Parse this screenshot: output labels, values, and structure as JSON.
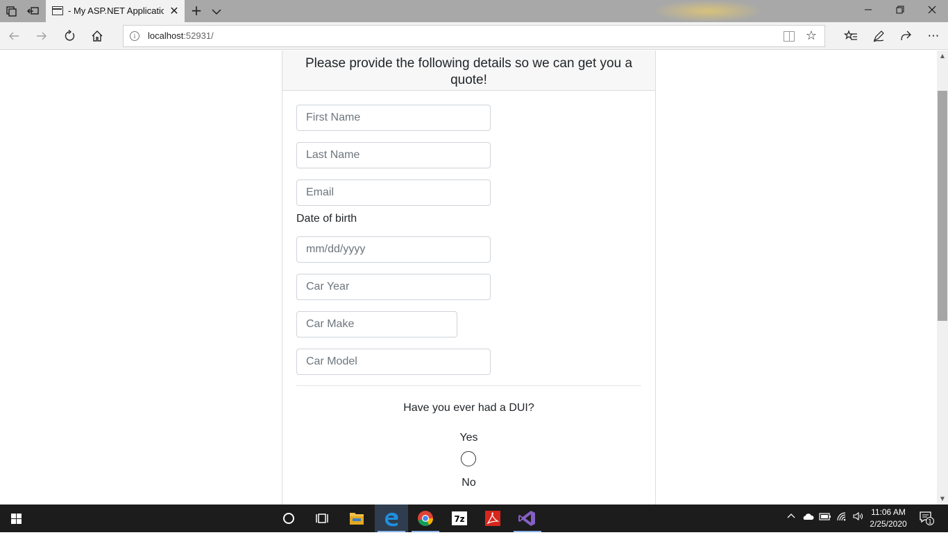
{
  "browser": {
    "tab_title": "- My ASP.NET Applicatio",
    "url_host": "localhost",
    "url_port": ":52931/"
  },
  "page": {
    "heading": "Please provide the following details so we can get you a quote!",
    "fields": {
      "first_name": "First Name",
      "last_name": "Last Name",
      "email": "Email",
      "dob_label": "Date of birth",
      "dob_placeholder": "mm/dd/yyyy",
      "car_year": "Car Year",
      "car_make": "Car Make",
      "car_model": "Car Model"
    },
    "dui_question": "Have you ever had a DUI?",
    "dui_yes": "Yes",
    "dui_no": "No"
  },
  "taskbar": {
    "time": "11:06 AM",
    "date": "2/25/2020",
    "apps": [
      "cortana-icon",
      "task-view-icon",
      "file-explorer-icon",
      "edge-icon",
      "chrome-icon",
      "7zip-icon",
      "acrobat-icon",
      "visual-studio-icon"
    ],
    "notification_count": "1"
  }
}
